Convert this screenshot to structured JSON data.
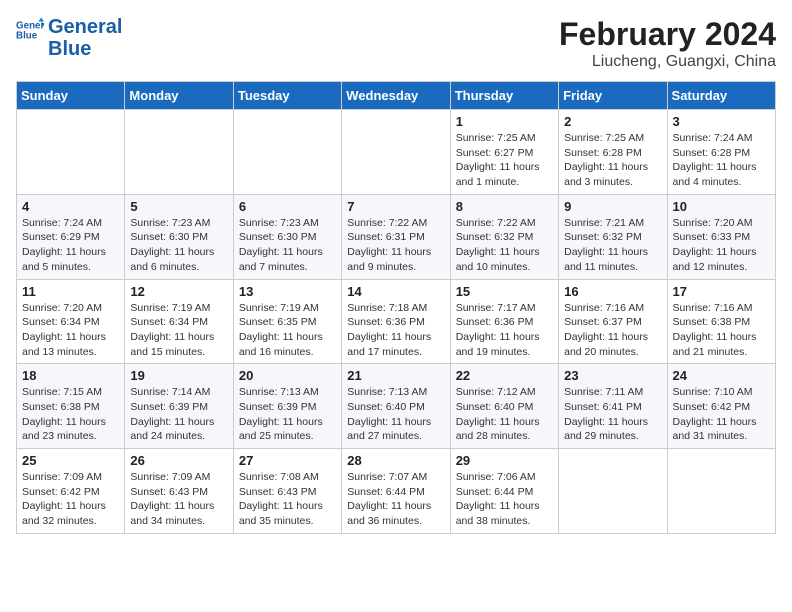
{
  "header": {
    "logo_text_general": "General",
    "logo_text_blue": "Blue",
    "title": "February 2024",
    "subtitle": "Liucheng, Guangxi, China"
  },
  "days_of_week": [
    "Sunday",
    "Monday",
    "Tuesday",
    "Wednesday",
    "Thursday",
    "Friday",
    "Saturday"
  ],
  "weeks": [
    [
      {
        "day": "",
        "info": ""
      },
      {
        "day": "",
        "info": ""
      },
      {
        "day": "",
        "info": ""
      },
      {
        "day": "",
        "info": ""
      },
      {
        "day": "1",
        "info": "Sunrise: 7:25 AM\nSunset: 6:27 PM\nDaylight: 11 hours and 1 minute."
      },
      {
        "day": "2",
        "info": "Sunrise: 7:25 AM\nSunset: 6:28 PM\nDaylight: 11 hours and 3 minutes."
      },
      {
        "day": "3",
        "info": "Sunrise: 7:24 AM\nSunset: 6:28 PM\nDaylight: 11 hours and 4 minutes."
      }
    ],
    [
      {
        "day": "4",
        "info": "Sunrise: 7:24 AM\nSunset: 6:29 PM\nDaylight: 11 hours and 5 minutes."
      },
      {
        "day": "5",
        "info": "Sunrise: 7:23 AM\nSunset: 6:30 PM\nDaylight: 11 hours and 6 minutes."
      },
      {
        "day": "6",
        "info": "Sunrise: 7:23 AM\nSunset: 6:30 PM\nDaylight: 11 hours and 7 minutes."
      },
      {
        "day": "7",
        "info": "Sunrise: 7:22 AM\nSunset: 6:31 PM\nDaylight: 11 hours and 9 minutes."
      },
      {
        "day": "8",
        "info": "Sunrise: 7:22 AM\nSunset: 6:32 PM\nDaylight: 11 hours and 10 minutes."
      },
      {
        "day": "9",
        "info": "Sunrise: 7:21 AM\nSunset: 6:32 PM\nDaylight: 11 hours and 11 minutes."
      },
      {
        "day": "10",
        "info": "Sunrise: 7:20 AM\nSunset: 6:33 PM\nDaylight: 11 hours and 12 minutes."
      }
    ],
    [
      {
        "day": "11",
        "info": "Sunrise: 7:20 AM\nSunset: 6:34 PM\nDaylight: 11 hours and 13 minutes."
      },
      {
        "day": "12",
        "info": "Sunrise: 7:19 AM\nSunset: 6:34 PM\nDaylight: 11 hours and 15 minutes."
      },
      {
        "day": "13",
        "info": "Sunrise: 7:19 AM\nSunset: 6:35 PM\nDaylight: 11 hours and 16 minutes."
      },
      {
        "day": "14",
        "info": "Sunrise: 7:18 AM\nSunset: 6:36 PM\nDaylight: 11 hours and 17 minutes."
      },
      {
        "day": "15",
        "info": "Sunrise: 7:17 AM\nSunset: 6:36 PM\nDaylight: 11 hours and 19 minutes."
      },
      {
        "day": "16",
        "info": "Sunrise: 7:16 AM\nSunset: 6:37 PM\nDaylight: 11 hours and 20 minutes."
      },
      {
        "day": "17",
        "info": "Sunrise: 7:16 AM\nSunset: 6:38 PM\nDaylight: 11 hours and 21 minutes."
      }
    ],
    [
      {
        "day": "18",
        "info": "Sunrise: 7:15 AM\nSunset: 6:38 PM\nDaylight: 11 hours and 23 minutes."
      },
      {
        "day": "19",
        "info": "Sunrise: 7:14 AM\nSunset: 6:39 PM\nDaylight: 11 hours and 24 minutes."
      },
      {
        "day": "20",
        "info": "Sunrise: 7:13 AM\nSunset: 6:39 PM\nDaylight: 11 hours and 25 minutes."
      },
      {
        "day": "21",
        "info": "Sunrise: 7:13 AM\nSunset: 6:40 PM\nDaylight: 11 hours and 27 minutes."
      },
      {
        "day": "22",
        "info": "Sunrise: 7:12 AM\nSunset: 6:40 PM\nDaylight: 11 hours and 28 minutes."
      },
      {
        "day": "23",
        "info": "Sunrise: 7:11 AM\nSunset: 6:41 PM\nDaylight: 11 hours and 29 minutes."
      },
      {
        "day": "24",
        "info": "Sunrise: 7:10 AM\nSunset: 6:42 PM\nDaylight: 11 hours and 31 minutes."
      }
    ],
    [
      {
        "day": "25",
        "info": "Sunrise: 7:09 AM\nSunset: 6:42 PM\nDaylight: 11 hours and 32 minutes."
      },
      {
        "day": "26",
        "info": "Sunrise: 7:09 AM\nSunset: 6:43 PM\nDaylight: 11 hours and 34 minutes."
      },
      {
        "day": "27",
        "info": "Sunrise: 7:08 AM\nSunset: 6:43 PM\nDaylight: 11 hours and 35 minutes."
      },
      {
        "day": "28",
        "info": "Sunrise: 7:07 AM\nSunset: 6:44 PM\nDaylight: 11 hours and 36 minutes."
      },
      {
        "day": "29",
        "info": "Sunrise: 7:06 AM\nSunset: 6:44 PM\nDaylight: 11 hours and 38 minutes."
      },
      {
        "day": "",
        "info": ""
      },
      {
        "day": "",
        "info": ""
      }
    ]
  ]
}
